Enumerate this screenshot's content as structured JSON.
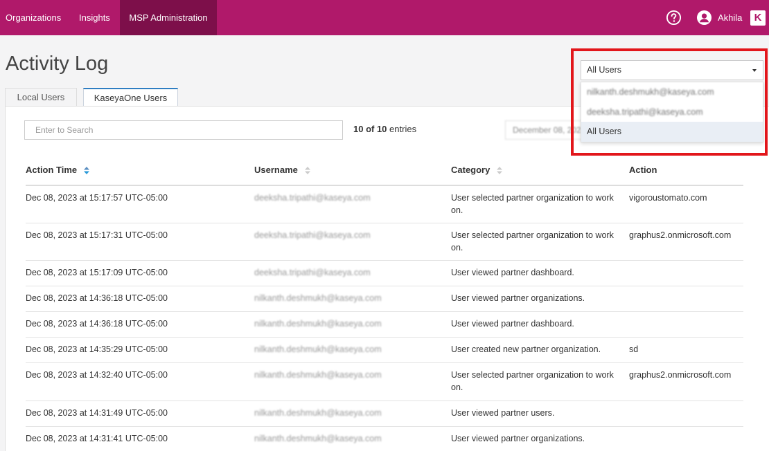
{
  "nav": {
    "items": [
      "Organizations",
      "Insights",
      "MSP Administration"
    ],
    "active": "MSP Administration",
    "user_name": "Akhila",
    "logo_letter": "K",
    "brand_color": "#b0196a"
  },
  "page": {
    "title": "Activity Log",
    "tabs": [
      "Local Users",
      "KaseyaOne Users"
    ],
    "active_tab": "KaseyaOne Users"
  },
  "search": {
    "placeholder": "Enter to Search"
  },
  "entries": {
    "shown": "10 of 10",
    "suffix": "entries"
  },
  "date_filter": {
    "value": "December 08, 2023"
  },
  "user_filter": {
    "selected": "All Users",
    "options": [
      "nilkanth.deshmukh@kaseya.com",
      "deeksha.tripathi@kaseya.com",
      "All Users"
    ]
  },
  "table": {
    "headers": [
      "Action Time",
      "Username",
      "Category",
      "Action"
    ],
    "rows": [
      {
        "time": "Dec 08, 2023 at 15:17:57 UTC-05:00",
        "user": "deeksha.tripathi@kaseya.com",
        "category": "User selected partner organization to work on.",
        "action": "vigoroustomato.com"
      },
      {
        "time": "Dec 08, 2023 at 15:17:31 UTC-05:00",
        "user": "deeksha.tripathi@kaseya.com",
        "category": "User selected partner organization to work on.",
        "action": "graphus2.onmicrosoft.com"
      },
      {
        "time": "Dec 08, 2023 at 15:17:09 UTC-05:00",
        "user": "deeksha.tripathi@kaseya.com",
        "category": "User viewed partner dashboard.",
        "action": ""
      },
      {
        "time": "Dec 08, 2023 at 14:36:18 UTC-05:00",
        "user": "nilkanth.deshmukh@kaseya.com",
        "category": "User viewed partner organizations.",
        "action": ""
      },
      {
        "time": "Dec 08, 2023 at 14:36:18 UTC-05:00",
        "user": "nilkanth.deshmukh@kaseya.com",
        "category": "User viewed partner dashboard.",
        "action": ""
      },
      {
        "time": "Dec 08, 2023 at 14:35:29 UTC-05:00",
        "user": "nilkanth.deshmukh@kaseya.com",
        "category": "User created new partner organization.",
        "action": "sd"
      },
      {
        "time": "Dec 08, 2023 at 14:32:40 UTC-05:00",
        "user": "nilkanth.deshmukh@kaseya.com",
        "category": "User selected partner organization to work on.",
        "action": "graphus2.onmicrosoft.com"
      },
      {
        "time": "Dec 08, 2023 at 14:31:49 UTC-05:00",
        "user": "nilkanth.deshmukh@kaseya.com",
        "category": "User viewed partner users.",
        "action": ""
      },
      {
        "time": "Dec 08, 2023 at 14:31:41 UTC-05:00",
        "user": "nilkanth.deshmukh@kaseya.com",
        "category": "User viewed partner organizations.",
        "action": ""
      }
    ]
  },
  "highlight_color": "#e2161b"
}
